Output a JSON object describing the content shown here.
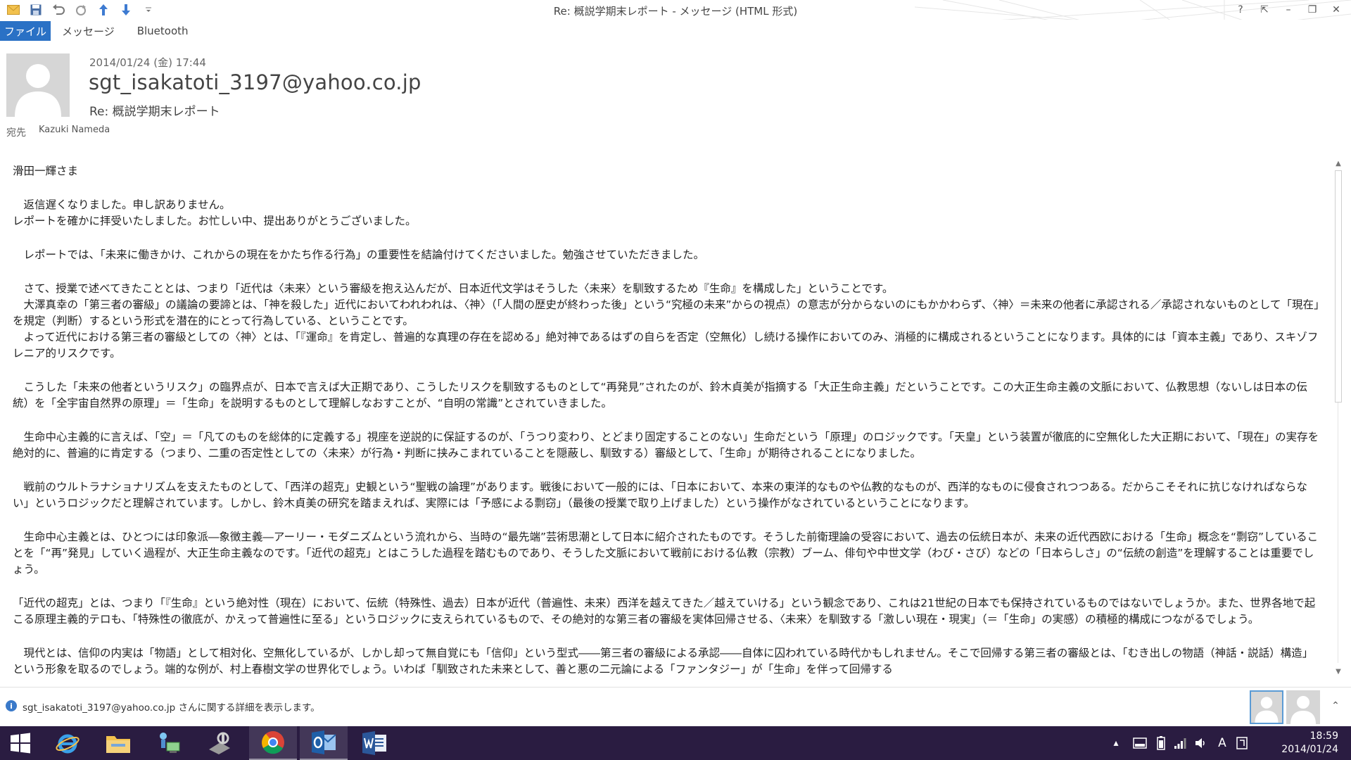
{
  "window": {
    "title": "Re: 概説学期末レポート - メッセージ (HTML 形式)",
    "controls": [
      "?",
      "⇱",
      "–",
      "❐",
      "✕"
    ]
  },
  "ribbon": {
    "tabs": [
      "ファイル",
      "メッセージ",
      "Bluetooth"
    ]
  },
  "message": {
    "date": "2014/01/24 (金) 17:44",
    "from": "sgt_isakatoti_3197@yahoo.co.jp",
    "subject": "Re: 概説学期末レポート",
    "to_label": "宛先",
    "to_name": "Kazuki Nameda"
  },
  "body": {
    "paragraphs": [
      "滑田一輝さま",
      "　返信遅くなりました。申し訳ありません。\nレポートを確かに拝受いたしました。お忙しい中、提出ありがとうございました。",
      "　レポートでは、「未来に働きかけ、これからの現在をかたち作る行為」の重要性を結論付けてくださいました。勉強させていただきました。",
      "　さて、授業で述べてきたこととは、つまり「近代は〈未来〉という審級を抱え込んだが、日本近代文学はそうした〈未来〉を馴致するため『生命』を構成した」ということです。\n　大澤真幸の「第三者の審級」の議論の要諦とは、「神を殺した」近代においてわれわれは、〈神〉（「人間の歴史が終わった後」という“究極の未来”からの視点）の意志が分からないのにもかかわらず、〈神〉＝未来の他者に承認される／承認されないものとして「現在」を規定（判断）するという形式を潜在的にとって行為している、ということです。\n　よって近代における第三者の審級としての〈神〉とは、「『運命』を肯定し、普遍的な真理の存在を認める」絶対神であるはずの自らを否定（空無化）し続ける操作においてのみ、消極的に構成されるということになります。具体的には「資本主義」であり、スキゾフレニア的リスクです。",
      "　こうした「未来の他者というリスク」の臨界点が、日本で言えば大正期であり、こうしたリスクを馴致するものとして“再発見”されたのが、鈴木貞美が指摘する「大正生命主義」だということです。この大正生命主義の文脈において、仏教思想（ないしは日本の伝統）を「全宇宙自然界の原理」＝「生命」を説明するものとして理解しなおすことが、“自明の常識”とされていきました。",
      "　生命中心主義的に言えば、「空」＝「凡てのものを総体的に定義する」視座を逆説的に保証するのが、「うつり変わり、とどまり固定することのない」生命だという「原理」のロジックです。「天皇」という装置が徹底的に空無化した大正期において、「現在」の実存を絶対的に、普遍的に肯定する（つまり、二重の否定性としての〈未来〉が行為・判断に挟みこまれていることを隠蔽し、馴致する）審級として、「生命」が期待されることになりました。",
      "　戦前のウルトラナショナリズムを支えたものとして、「西洋の超克」史観という“聖戦の論理”があります。戦後において一般的には、「日本において、本来の東洋的なものや仏教的なものが、西洋的なものに侵食されつつある。だからこそそれに抗じなければならない」というロジックだと理解されています。しかし、鈴木貞美の研究を踏まえれば、実際には「予感による剽窃」（最後の授業で取り上げました）という操作がなされているということになります。",
      "　生命中心主義とは、ひとつには印象派―象徴主義―アーリー・モダニズムという流れから、当時の“最先端”芸術思潮として日本に紹介されたものです。そうした前衛理論の受容において、過去の伝統日本が、未来の近代西欧における「生命」概念を“剽窃”していることを「“再”発見」していく過程が、大正生命主義なのです。「近代の超克」とはこうした過程を踏むものであり、そうした文脈において戦前における仏教（宗教）ブーム、俳句や中世文学（わび・さび）などの「日本らしさ」の“伝統の創造”を理解することは重要でしょう。",
      "「近代の超克」とは、つまり「『生命』という絶対性（現在）において、伝統（特殊性、過去）日本が近代（普遍性、未来）西洋を越えてきた／越えていける」という観念であり、これは21世紀の日本でも保持されているものではないでしょうか。また、世界各地で起こる原理主義的テロも、「特殊性の徹底が、かえって普遍性に至る」というロジックに支えられているもので、その絶対的な第三者の審級を実体回帰させる、〈未来〉を馴致する「激しい現在・現実」（＝「生命」の実感）の積極的構成につながるでしょう。",
      "　現代とは、信仰の内実は「物語」として相対化、空無化しているが、しかし却って無自覚にも「信仰」という型式――第三者の審級による承認――自体に囚われている時代かもしれません。そこで回帰する第三者の審級とは、「むき出しの物語（神話・説話）構造」という形象を取るのでしょう。端的な例が、村上春樹文学の世界化でしょう。いわば「馴致された未来として、善と悪の二元論による「ファンタジー」が「生命」を伴って回帰する"
    ]
  },
  "people_pane": {
    "info_text": "sgt_isakatoti_3197@yahoo.co.jp さんに関する詳細を表示します。"
  },
  "taskbar": {
    "time": "18:59",
    "date": "2014/01/24",
    "ime": "A"
  },
  "colors": {
    "file_tab": "#2a71c5",
    "taskbar": "#2a1c41",
    "info_icon": "#3a79c9"
  }
}
